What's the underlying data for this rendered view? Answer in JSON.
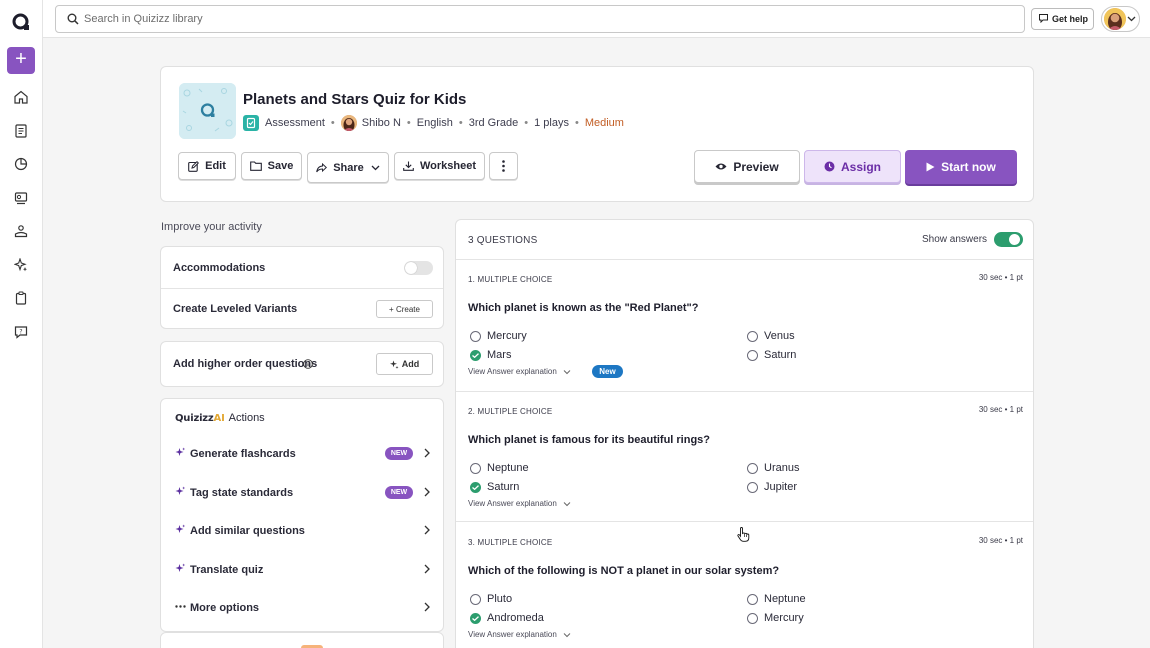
{
  "search": {
    "placeholder": "Search in Quizizz library"
  },
  "topbar": {
    "get_help": "Get help"
  },
  "quiz": {
    "title": "Planets and Stars Quiz for Kids",
    "type": "Assessment",
    "author": "Shibo N",
    "language": "English",
    "grade": "3rd Grade",
    "plays": "1 plays",
    "difficulty": "Medium"
  },
  "toolbar": {
    "edit": "Edit",
    "save": "Save",
    "share": "Share",
    "worksheet": "Worksheet",
    "preview": "Preview",
    "assign": "Assign",
    "start": "Start now"
  },
  "improve": {
    "label": "Improve your activity",
    "accommodations": "Accommodations",
    "leveled_variants": "Create Leveled Variants",
    "create_btn": "+ Create",
    "higher_order": "Add higher order questions",
    "add_btn": "Add"
  },
  "ai_actions": {
    "brand_main": "Quizizz",
    "brand_ai": "AI",
    "title": "Actions",
    "items": [
      {
        "label": "Generate flashcards",
        "badge": "NEW"
      },
      {
        "label": "Tag state standards",
        "badge": "NEW"
      },
      {
        "label": "Add similar questions",
        "badge": ""
      },
      {
        "label": "Translate quiz",
        "badge": ""
      },
      {
        "label": "More options",
        "badge": ""
      }
    ]
  },
  "questions": {
    "count_label": "3 QUESTIONS",
    "show_answers": "Show answers",
    "view_explanation": "View Answer explanation",
    "new_pill": "New",
    "list": [
      {
        "type": "1. MULTIPLE CHOICE",
        "meta": "30 sec • 1 pt",
        "text": "Which planet is known as the \"Red Planet\"?",
        "options": [
          "Mercury",
          "Venus",
          "Mars",
          "Saturn"
        ],
        "correct": "Mars"
      },
      {
        "type": "2. MULTIPLE CHOICE",
        "meta": "30 sec • 1 pt",
        "text": "Which planet is famous for its beautiful rings?",
        "options": [
          "Neptune",
          "Uranus",
          "Saturn",
          "Jupiter"
        ],
        "correct": "Saturn"
      },
      {
        "type": "3. MULTIPLE CHOICE",
        "meta": "30 sec • 1 pt",
        "text": "Which of the following is NOT a planet in our solar system?",
        "options": [
          "Pluto",
          "Neptune",
          "Andromeda",
          "Mercury"
        ],
        "correct": "Andromeda"
      }
    ]
  },
  "colors": {
    "brand": "#8854c0",
    "correct": "#2c9d6e",
    "difficulty": "#c25d24",
    "new_pill": "#1d77c3"
  }
}
